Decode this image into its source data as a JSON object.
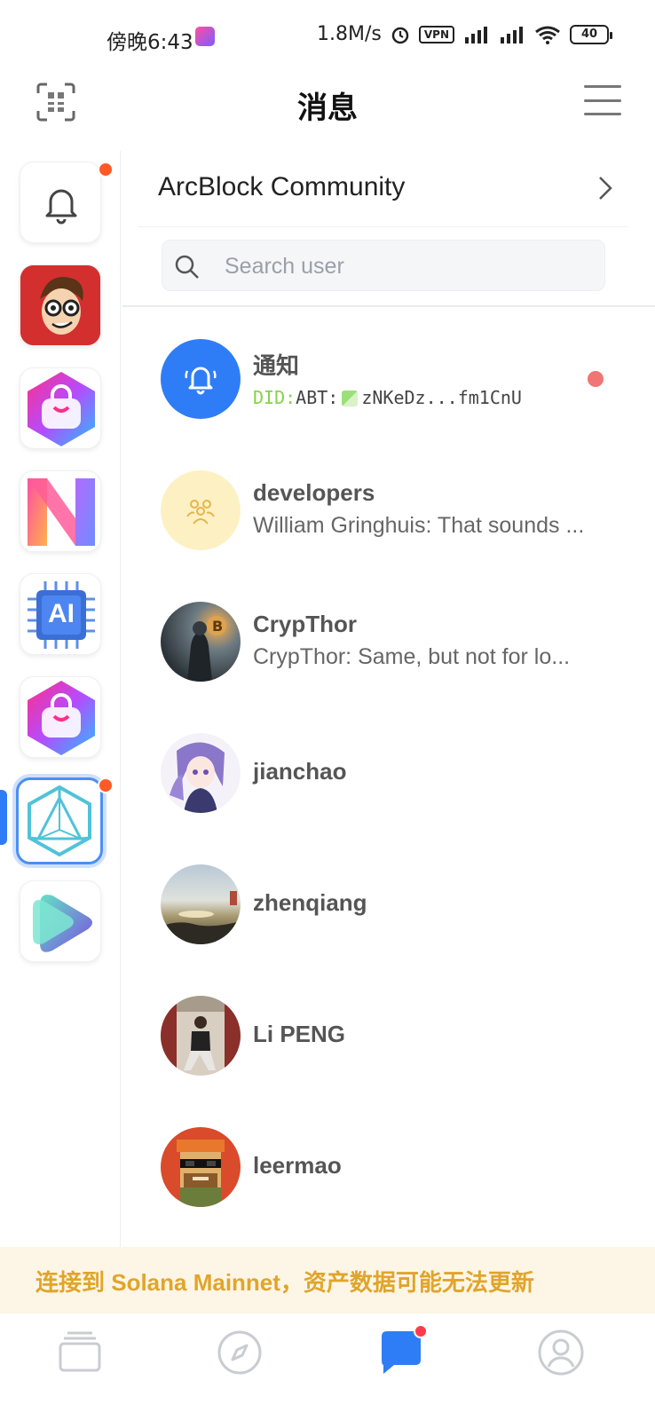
{
  "status_bar": {
    "time": "傍晚6:43",
    "network_speed": "1.8M/s",
    "vpn_label": "VPN",
    "battery": "40"
  },
  "header": {
    "title": "消息"
  },
  "sidebar": {
    "items": [
      {
        "icon": "bell-icon",
        "has_dot": true
      },
      {
        "icon": "cartoon-avatar-app-icon"
      },
      {
        "icon": "shopping-bag-app-icon"
      },
      {
        "icon": "n-letter-app-icon"
      },
      {
        "icon": "ai-chip-app-icon",
        "label": "AI"
      },
      {
        "icon": "shopping-bag-app-icon"
      },
      {
        "icon": "arcblock-cube-app-icon",
        "active": true,
        "has_dot": true
      },
      {
        "icon": "play-shape-app-icon"
      }
    ]
  },
  "community": {
    "name": "ArcBlock Community"
  },
  "search": {
    "placeholder": "Search user"
  },
  "chats": [
    {
      "name": "通知",
      "did_prefix": "DID:",
      "did_type": "ABT:",
      "did_value": "zNKeDz...fm1CnU",
      "unread": true
    },
    {
      "name": "developers",
      "preview": "William Gringhuis: That sounds ..."
    },
    {
      "name": "CrypThor",
      "preview": "CrypThor: Same, but not for lo..."
    },
    {
      "name": "jianchao",
      "preview": ""
    },
    {
      "name": "zhenqiang",
      "preview": ""
    },
    {
      "name": "Li PENG",
      "preview": ""
    },
    {
      "name": "leermao",
      "preview": ""
    }
  ],
  "banner": {
    "text": "连接到 Solana Mainnet，资产数据可能无法更新"
  },
  "bottom_nav": {
    "items": [
      "wallet-icon",
      "compass-icon",
      "chat-icon",
      "profile-icon"
    ]
  },
  "colors": {
    "accent": "#2f7df6",
    "badge": "#ff5a26",
    "banner_text": "#e0a52a"
  }
}
